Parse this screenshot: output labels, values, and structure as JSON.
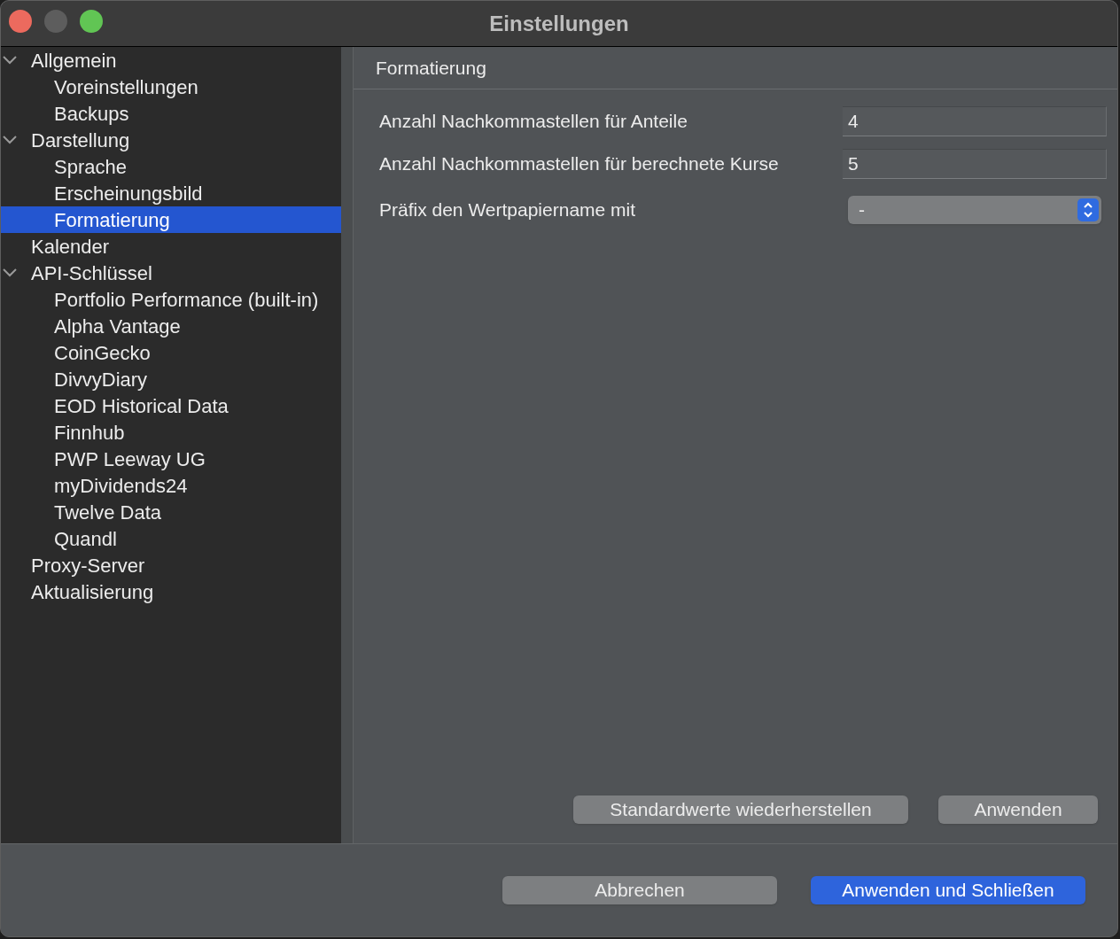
{
  "window": {
    "title": "Einstellungen"
  },
  "sidebar": {
    "items": [
      {
        "label": "Allgemein",
        "expanded": true,
        "selected": false,
        "children": [
          {
            "label": "Voreinstellungen",
            "selected": false
          },
          {
            "label": "Backups",
            "selected": false
          }
        ]
      },
      {
        "label": "Darstellung",
        "expanded": true,
        "selected": false,
        "children": [
          {
            "label": "Sprache",
            "selected": false
          },
          {
            "label": "Erscheinungsbild",
            "selected": false
          },
          {
            "label": "Formatierung",
            "selected": true
          }
        ]
      },
      {
        "label": "Kalender",
        "selected": false
      },
      {
        "label": "API-Schlüssel",
        "expanded": true,
        "selected": false,
        "children": [
          {
            "label": "Portfolio Performance (built-in)",
            "selected": false
          },
          {
            "label": "Alpha Vantage",
            "selected": false
          },
          {
            "label": "CoinGecko",
            "selected": false
          },
          {
            "label": "DivvyDiary",
            "selected": false
          },
          {
            "label": "EOD Historical Data",
            "selected": false
          },
          {
            "label": "Finnhub",
            "selected": false
          },
          {
            "label": "PWP Leeway UG",
            "selected": false
          },
          {
            "label": "myDividends24",
            "selected": false
          },
          {
            "label": "Twelve Data",
            "selected": false
          },
          {
            "label": "Quandl",
            "selected": false
          }
        ]
      },
      {
        "label": "Proxy-Server",
        "selected": false
      },
      {
        "label": "Aktualisierung",
        "selected": false
      }
    ]
  },
  "page": {
    "title": "Formatierung",
    "fields": [
      {
        "kind": "text",
        "label": "Anzahl Nachkommastellen für Anteile",
        "value": "4"
      },
      {
        "kind": "text",
        "label": "Anzahl Nachkommastellen für berechnete Kurse",
        "value": "5"
      },
      {
        "kind": "select",
        "label": "Präfix den Wertpapiername mit",
        "value": "-"
      }
    ],
    "buttons": [
      {
        "label": "Standardwerte wiederherstellen",
        "kind": "default"
      },
      {
        "label": "Anwenden",
        "kind": "default"
      }
    ]
  },
  "footer": {
    "buttons": [
      {
        "label": "Abbrechen",
        "kind": "default"
      },
      {
        "label": "Anwenden und Schließen",
        "kind": "primary"
      }
    ]
  }
}
